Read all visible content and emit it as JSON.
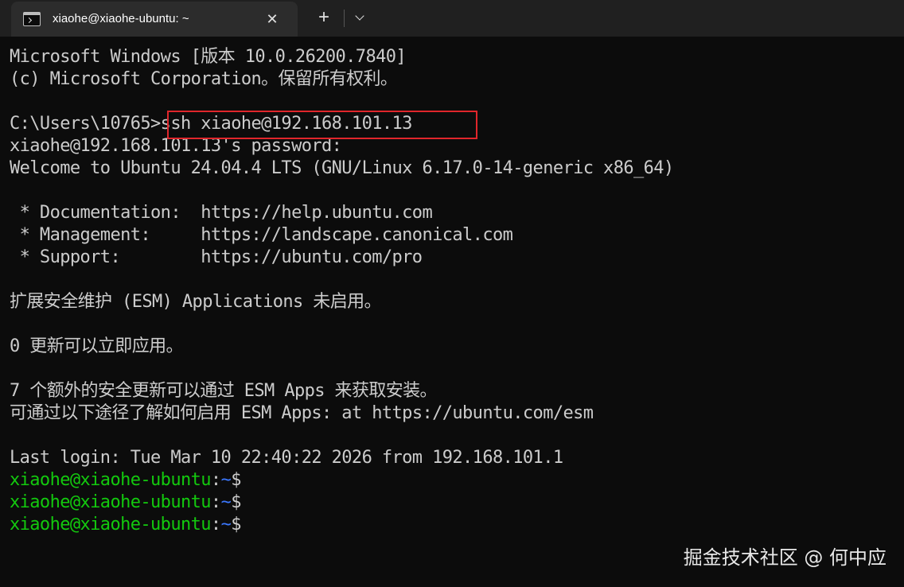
{
  "tab": {
    "title": "xiaohe@xiaohe-ubuntu: ~",
    "close_glyph": "✕",
    "new_tab_glyph": "+",
    "icon": "terminal-icon"
  },
  "colors": {
    "background": "#0c0c0c",
    "text": "#cccccc",
    "prompt_user": "#13c90e",
    "prompt_path": "#3b78ff",
    "highlight_box": "#e0262b"
  },
  "terminal": {
    "lines": [
      "Microsoft Windows [版本 10.0.26200.7840]",
      "(c) Microsoft Corporation。保留所有权利。",
      "",
      "C:\\Users\\10765>ssh xiaohe@192.168.101.13",
      "xiaohe@192.168.101.13's password:",
      "Welcome to Ubuntu 24.04.4 LTS (GNU/Linux 6.17.0-14-generic x86_64)",
      "",
      " * Documentation:  https://help.ubuntu.com",
      " * Management:     https://landscape.canonical.com",
      " * Support:        https://ubuntu.com/pro",
      "",
      "扩展安全维护 (ESM) Applications 未启用。",
      "",
      "0 更新可以立即应用。",
      "",
      "7 个额外的安全更新可以通过 ESM Apps 来获取安装。",
      "可通过以下途径了解如何启用 ESM Apps: at https://ubuntu.com/esm",
      "",
      "Last login: Tue Mar 10 22:40:22 2026 from 192.168.101.1"
    ],
    "prompts": [
      {
        "user_host": "xiaohe@xiaohe-ubuntu",
        "sep": ":",
        "path": "~",
        "symbol": "$"
      },
      {
        "user_host": "xiaohe@xiaohe-ubuntu",
        "sep": ":",
        "path": "~",
        "symbol": "$"
      },
      {
        "user_host": "xiaohe@xiaohe-ubuntu",
        "sep": ":",
        "path": "~",
        "symbol": "$"
      }
    ]
  },
  "watermark": "掘金技术社区 @ 何中应"
}
